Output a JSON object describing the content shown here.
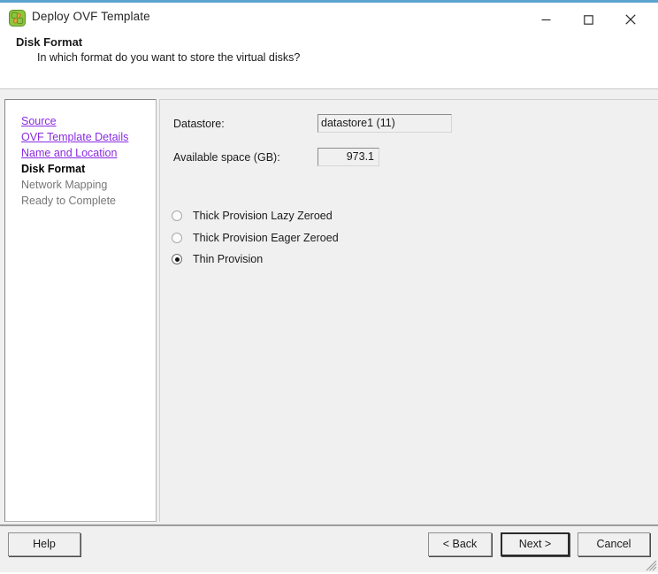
{
  "window": {
    "title": "Deploy OVF Template",
    "icon": "ovf-template-icon",
    "accent_color": "#5ba3d0",
    "controls": {
      "minimize": "minimize-icon",
      "maximize": "maximize-icon",
      "close": "close-icon"
    }
  },
  "header": {
    "title": "Disk Format",
    "subtitle": "In which format do you want to store the virtual disks?"
  },
  "sidebar": {
    "items": [
      {
        "label": "Source",
        "state": "done"
      },
      {
        "label": "OVF Template Details",
        "state": "done"
      },
      {
        "label": "Name and Location",
        "state": "done"
      },
      {
        "label": "Disk Format",
        "state": "current"
      },
      {
        "label": "Network Mapping",
        "state": "future"
      },
      {
        "label": "Ready to Complete",
        "state": "future"
      }
    ],
    "link_color": "#8a2be2",
    "future_color": "#777777"
  },
  "main": {
    "datastore": {
      "label": "Datastore:",
      "value": "datastore1 (11)"
    },
    "available_space": {
      "label": "Available space (GB):",
      "value": "973.1"
    },
    "disk_format_options": [
      {
        "label": "Thick Provision Lazy Zeroed",
        "selected": false
      },
      {
        "label": "Thick Provision Eager Zeroed",
        "selected": false
      },
      {
        "label": "Thin Provision",
        "selected": true
      }
    ]
  },
  "footer": {
    "help": "Help",
    "back": "< Back",
    "next": "Next >",
    "cancel": "Cancel"
  }
}
